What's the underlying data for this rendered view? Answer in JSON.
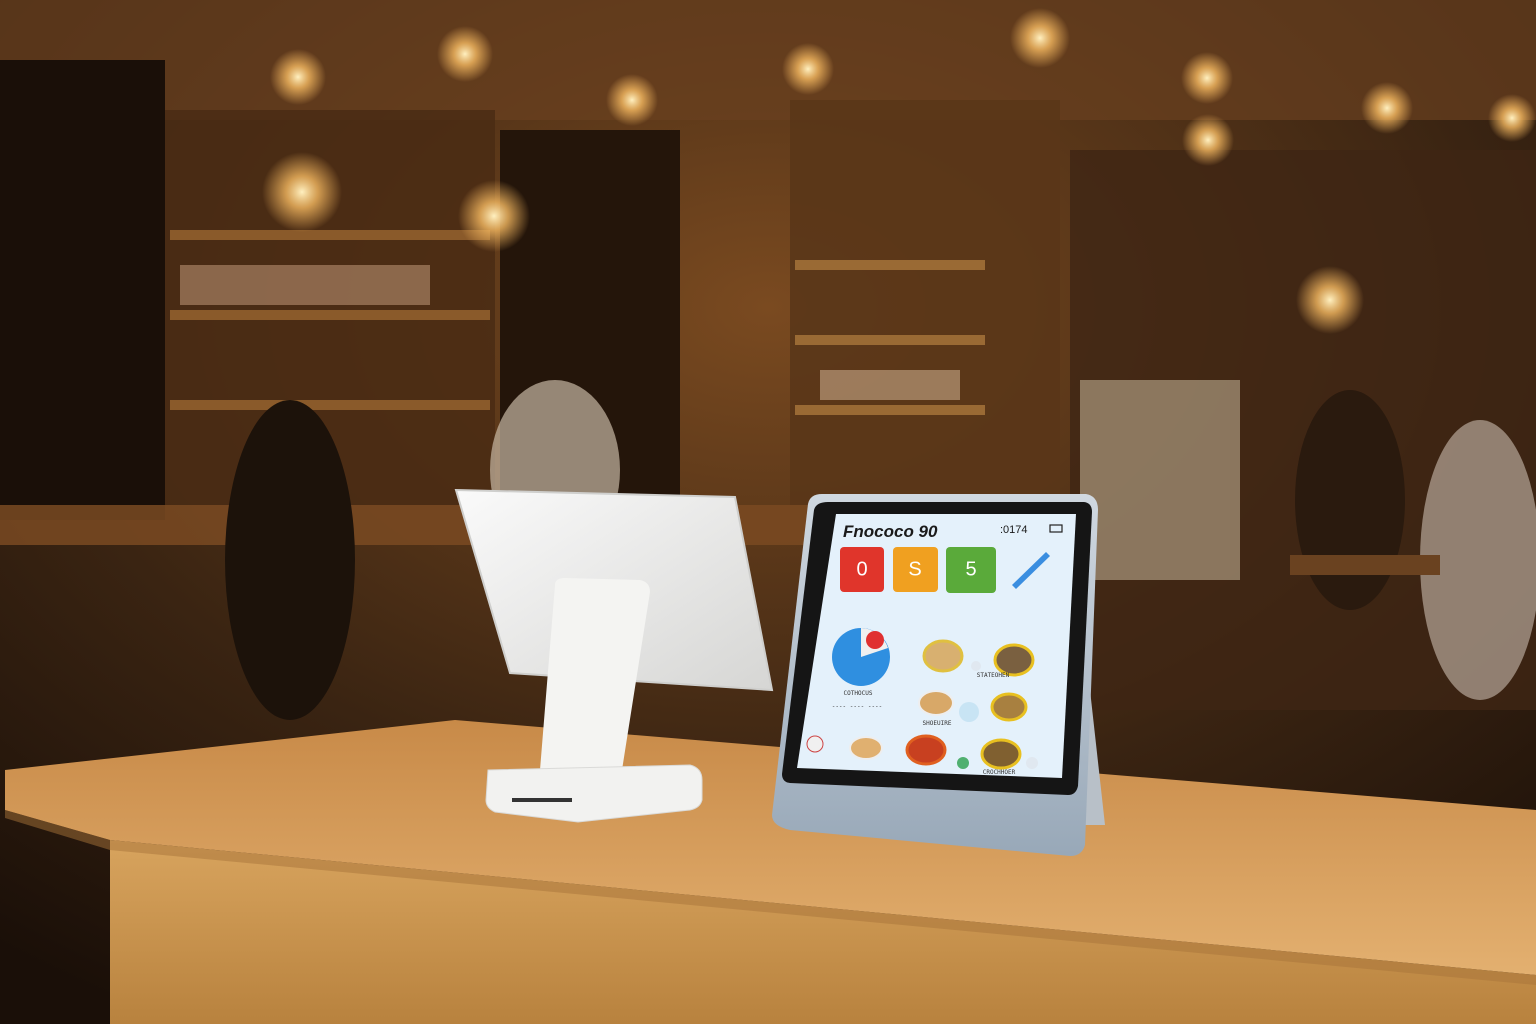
{
  "scene": {
    "description_tag": "cafe-counter-pos",
    "colors": {
      "wall_warm": "#5a3518",
      "counter_wood": "#d9a461",
      "stand_white": "#f2f2f0",
      "tile_red": "#e0352b",
      "tile_orange": "#f0a020",
      "tile_green": "#5aaa3a",
      "pie_blue": "#2f8fe0"
    }
  },
  "tablet": {
    "header_title": "Fnococo 90",
    "status_time": ":0174",
    "status_icon": "battery-icon",
    "tiles": [
      {
        "label": "0",
        "color": "#e0352b"
      },
      {
        "label": "S",
        "color": "#f0a020"
      },
      {
        "label": "5",
        "color": "#5aaa3a"
      }
    ],
    "pen_icon": "pen-icon",
    "pie_label": "COTHOCUS",
    "pie_caption": "---- ---- ----",
    "food_labels": [
      "STATEOHEN",
      "SHOEUIRE",
      "CROCHHOER"
    ]
  }
}
